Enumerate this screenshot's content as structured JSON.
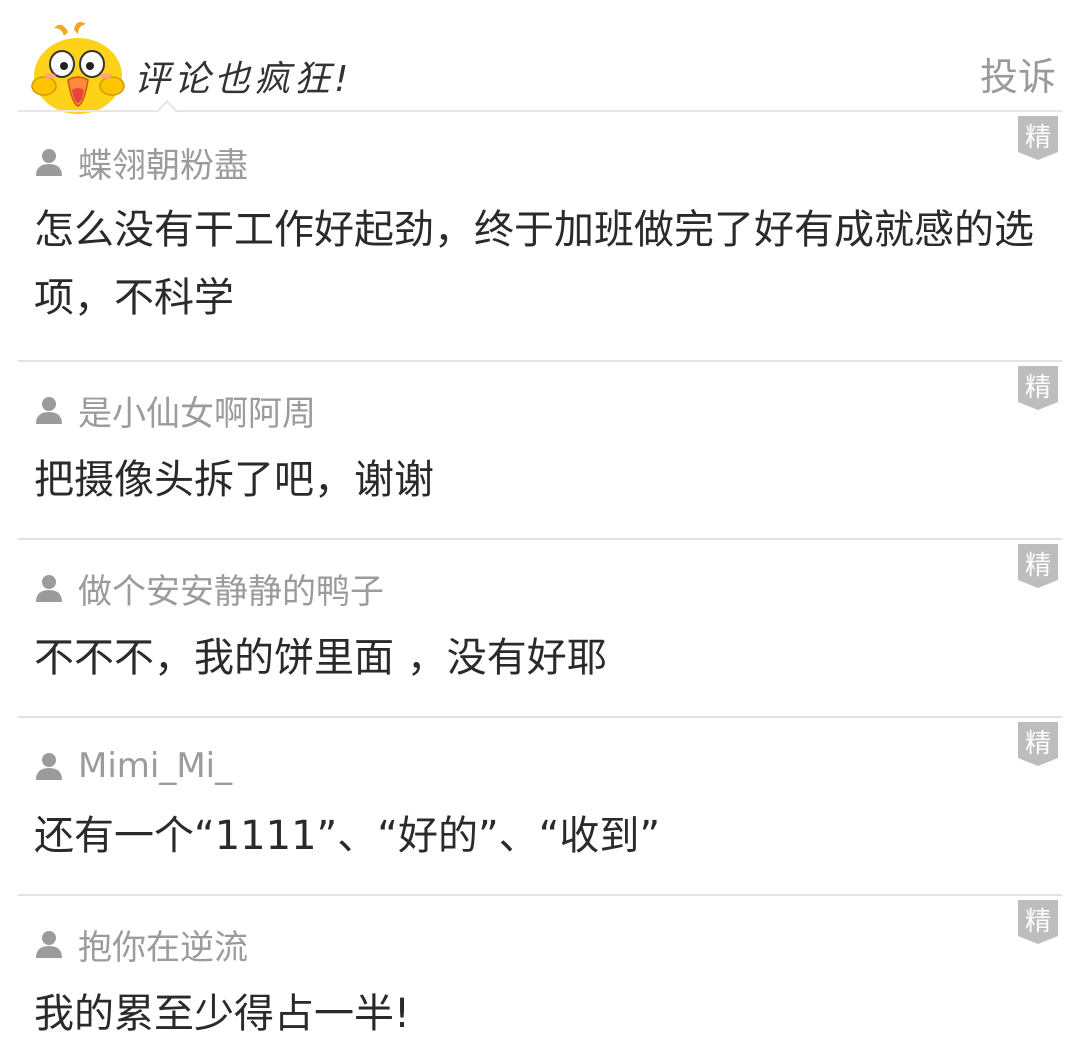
{
  "header": {
    "title": "评论也疯狂!",
    "report_label": "投诉"
  },
  "badge_label": "精",
  "comments": [
    {
      "username": "蝶翎朝粉盡",
      "text": "怎么没有干工作好起劲，终于加班做完了好有成就感的选项，不科学"
    },
    {
      "username": "是小仙女啊阿周",
      "text": "把摄像头拆了吧，谢谢"
    },
    {
      "username": "做个安安静静的鸭子",
      "text": "不不不，我的饼里面 ，没有好耶"
    },
    {
      "username": "Mimi_Mi_",
      "text": "还有一个“1111”、“好的”、“收到”"
    },
    {
      "username": "抱你在逆流",
      "text": "我的累至少得占一半!"
    }
  ],
  "colors": {
    "username": "#9b9b9b",
    "text": "#2a2a2a",
    "badge": "#bdbdbd",
    "mascot": "#ffd21a"
  }
}
